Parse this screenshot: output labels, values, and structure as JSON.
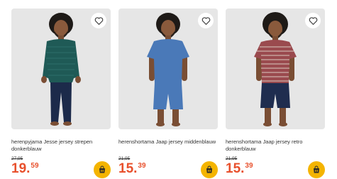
{
  "products": [
    {
      "title": "herenpyjama Jesse jersey strepen donkerblauw",
      "old_price": "27,95",
      "price_euros": "19.",
      "price_cents": "59",
      "shirt_color": "#1f5a56",
      "pants_color": "#1c2a4a"
    },
    {
      "title": "herenshortama Jaap jersey middenblauw",
      "old_price": "21,95",
      "price_euros": "15.",
      "price_cents": "39",
      "shirt_color": "#4a79b8",
      "pants_color": "#4a79b8"
    },
    {
      "title": "herenshortama Jaap jersey retro donkerblauw",
      "old_price": "21,95",
      "price_euros": "15.",
      "price_cents": "39",
      "shirt_color": "#9a4a4e",
      "pants_color": "#1f2d4f"
    }
  ],
  "colors": {
    "price": "#e8502c",
    "cart_button": "#f4b400",
    "image_bg": "#e6e6e6"
  },
  "icons": {
    "favorite": "heart-outline-icon",
    "cart": "shopping-bag-icon"
  }
}
